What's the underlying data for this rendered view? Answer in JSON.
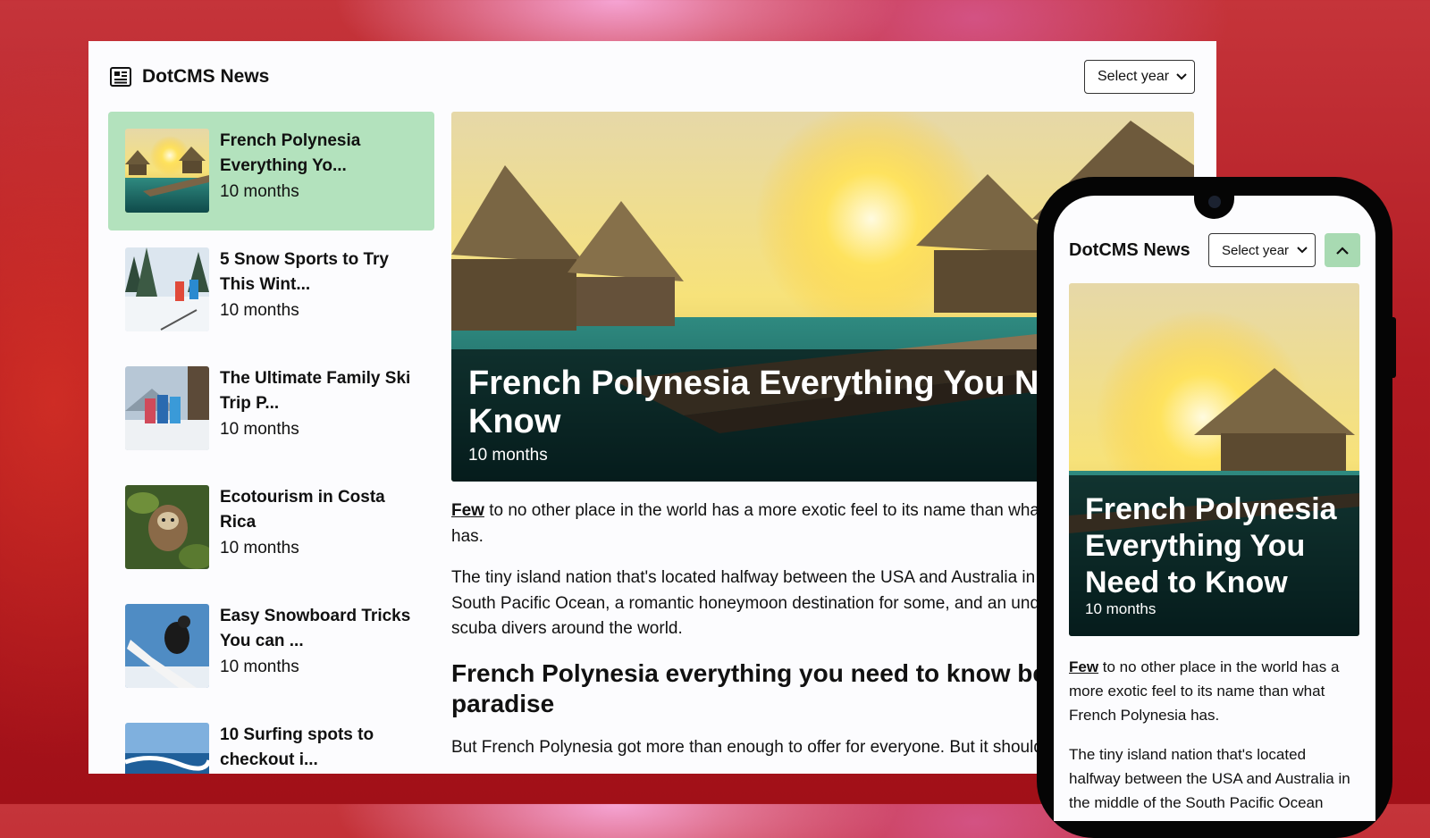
{
  "app": {
    "title": "DotCMS News",
    "select_year": "Select year"
  },
  "articles": [
    {
      "title": "French Polynesia Everything Yo...",
      "time": "10 months",
      "active": true
    },
    {
      "title": "5 Snow Sports to Try This Wint...",
      "time": "10 months"
    },
    {
      "title": "The Ultimate Family Ski Trip P...",
      "time": "10 months"
    },
    {
      "title": "Ecotourism in Costa Rica",
      "time": "10 months"
    },
    {
      "title": "Easy Snowboard Tricks You can ...",
      "time": "10 months"
    },
    {
      "title": "10 Surfing spots to checkout i...",
      "time": ""
    }
  ],
  "featured": {
    "title": "French Polynesia Everything You Need to Know",
    "time": "10 months",
    "p1_link": "Few",
    "p1_rest": " to no other place in the world has a more exotic feel to its name than what French Polynesia has.",
    "p2": "The tiny island nation that's located halfway between the USA and Australia in the middle of the South Pacific Ocean, a romantic honeymoon destination for some, and an underwater paradise for scuba divers around the world.",
    "h2": "French Polynesia everything you need to know before visiting paradise",
    "p3": "But French Polynesia got more than enough to offer for everyone. But it should"
  },
  "mobile": {
    "title": "DotCMS News",
    "select_year": "Select year",
    "hero_title": "French Polynesia Everything You Need to Know",
    "hero_time": "10 months",
    "p1_link": "Few",
    "p1_rest": " to no other place in the world has a more exotic feel to its name than what French Polynesia has.",
    "p2": "The tiny island nation that's located halfway between the USA and Australia in the middle of the South Pacific Ocean"
  },
  "icons": {
    "news": "newspaper-icon",
    "select": "chevron-down-icon",
    "scroll_top": "chevron-up-icon"
  },
  "colors": {
    "active_item": "#b3e2bd",
    "scroll_top_button": "#a8dab2"
  }
}
